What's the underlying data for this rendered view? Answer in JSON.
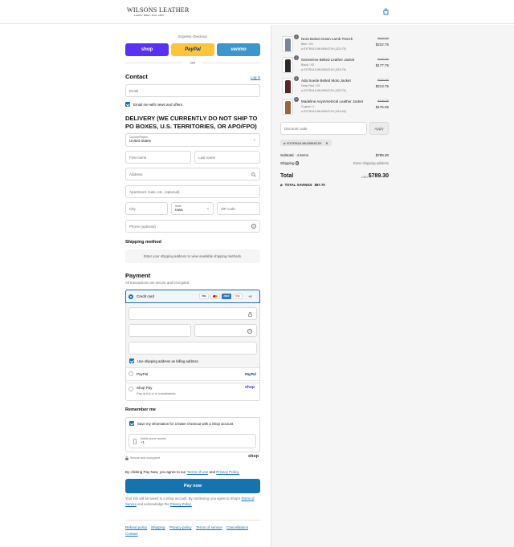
{
  "header": {
    "brand": "WILSONS LEATHER",
    "tagline": "Leather Made. Since 1899",
    "cart_icon": "bag-icon"
  },
  "express": {
    "title": "Express checkout",
    "shop_label": "shop",
    "paypal_label": "PayPal",
    "venmo_label": "venmo",
    "or_label": "OR",
    "colors": {
      "shop": "#5a31f4",
      "paypal": "#ffc439",
      "venmo": "#3d95ce"
    }
  },
  "contact": {
    "title": "Contact",
    "login_label": "Log in",
    "email_placeholder": "Email",
    "news_label": "Email me with news and offers"
  },
  "delivery": {
    "title": "DELIVERY (WE CURRENTLY DO NOT SHIP TO PO BOXES, U.S. TERRITORIES, OR APO/FPO)",
    "country_label": "Country/Region",
    "country_value": "United States",
    "first_name": "First name",
    "last_name": "Last name",
    "address": "Address",
    "apartment": "Apartment, suite, etc. (optional)",
    "city": "City",
    "state_label": "State",
    "state_value": "Iowa",
    "zip": "ZIP code",
    "phone": "Phone (optional)"
  },
  "shipping": {
    "title": "Shipping method",
    "notice": "Enter your shipping address to view available shipping methods."
  },
  "payment": {
    "title": "Payment",
    "subtitle": "All transactions are secure and encrypted.",
    "credit_card_label": "Credit card",
    "card_icons": [
      "VISA",
      "MC",
      "AMEX",
      "DISC"
    ],
    "more_cards": "+5",
    "billing_label": "Use shipping address as billing address",
    "paypal_label": "PayPal",
    "paypal_logo": "PayPal",
    "shoppay_label": "Shop Pay",
    "shoppay_sub": "Pay in full or in installments",
    "shoppay_logo": "shop"
  },
  "remember": {
    "title": "Remember me",
    "save_label": "Save my information for a faster checkout with a Shop account",
    "mobile_label": "Mobile phone number",
    "mobile_prefix": "+1",
    "secure_label": "Secure and encrypted",
    "shop_logo": "shop"
  },
  "terms": {
    "prefix": "By clicking Pay Now, you agree to our",
    "terms_link": "Terms of Use",
    "and": "and",
    "privacy_link": "Privacy Policy.",
    "pay_button": "Pay now",
    "fine_1": "Your info will be saved to a Shop account. By continuing, you agree to Shop's",
    "fine_terms": "Terms of Service",
    "fine_2": "and acknowledge the",
    "fine_privacy": "Privacy Policy."
  },
  "footer": {
    "links": [
      "Refund policy",
      "Shipping",
      "Privacy policy",
      "Terms of service",
      "Cancellations",
      "Contact"
    ]
  },
  "summary": {
    "items": [
      {
        "qty": "1",
        "name": "Nora Button Down Lamb Trench",
        "variant": "Blue / XS",
        "discount": "EXTRA10-WLKBKATJH (-$24.75)",
        "old_price": "$247.50",
        "new_price": "$222.75"
      },
      {
        "qty": "1",
        "name": "Genevieve Belted Leather Jacket",
        "variant": "Black / XS",
        "discount": "EXTRA10-WLKBKATJH (-$19.75)",
        "old_price": "$197.50",
        "new_price": "$177.75"
      },
      {
        "qty": "1",
        "name": "Ada Suede Belted Moto Jacket",
        "variant": "Deep Red / XS",
        "discount": "EXTRA10-WLKBKATJH (-$23.75)",
        "old_price": "$237.50",
        "new_price": "$213.75"
      },
      {
        "qty": "1",
        "name": "Madeline Asymmetrical Leather Jacket",
        "variant": "Cognac / L",
        "discount": "EXTRA10-WLKBKATJH (-$19.45)",
        "old_price": "$194.50",
        "new_price": "$175.05"
      }
    ],
    "discount_placeholder": "Discount code",
    "apply_label": "Apply",
    "applied_code": "EXTRA10-WLKBKATJH",
    "subtotal_label": "Subtotal · 4 items",
    "subtotal_value": "$789.30",
    "shipping_label": "Shipping",
    "shipping_value": "Enter shipping address",
    "total_label": "Total",
    "currency": "USD",
    "total_value": "$789.30",
    "savings_label": "TOTAL SAVINGS",
    "savings_value": "$87.70",
    "thumb_colors": [
      "#7a8598",
      "#2a2a2a",
      "#5a2424",
      "#9a6440"
    ]
  }
}
